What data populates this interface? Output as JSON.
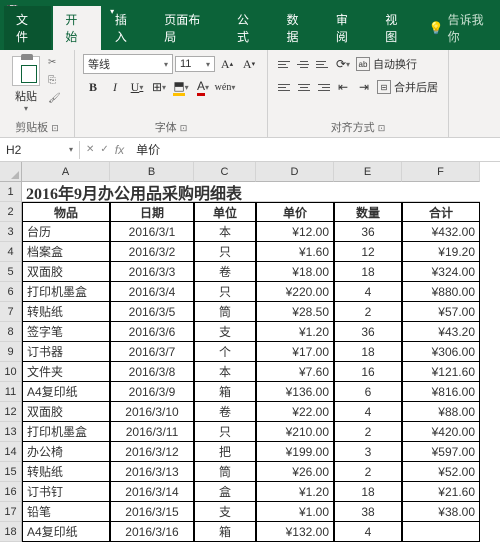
{
  "qat": {
    "save": "💾",
    "undo": "↶",
    "redo": "↷"
  },
  "tabs": {
    "file": "文件",
    "home": "开始",
    "insert": "插入",
    "layout": "页面布局",
    "formulas": "公式",
    "data": "数据",
    "review": "审阅",
    "view": "视图",
    "tell": "告诉我你"
  },
  "ribbon": {
    "paste": "粘贴",
    "clipboard": "剪贴板",
    "font_name": "等线",
    "font_size": "11",
    "font_group": "字体",
    "wrap": "自动换行",
    "merge": "合并后居",
    "align_group": "对齐方式"
  },
  "namebox": "H2",
  "formula": "单价",
  "columns": [
    "A",
    "B",
    "C",
    "D",
    "E",
    "F"
  ],
  "title": "2016年9月办公用品采购明细表",
  "headers": [
    "物品",
    "日期",
    "单位",
    "单价",
    "数量",
    "合计"
  ],
  "chart_data": {
    "type": "table",
    "title": "2016年9月办公用品采购明细表",
    "columns": [
      "物品",
      "日期",
      "单位",
      "单价",
      "数量",
      "合计"
    ],
    "rows": [
      [
        "台历",
        "2016/3/1",
        "本",
        "¥12.00",
        "36",
        "¥432.00"
      ],
      [
        "档案盒",
        "2016/3/2",
        "只",
        "¥1.60",
        "12",
        "¥19.20"
      ],
      [
        "双面胶",
        "2016/3/3",
        "卷",
        "¥18.00",
        "18",
        "¥324.00"
      ],
      [
        "打印机墨盒",
        "2016/3/4",
        "只",
        "¥220.00",
        "4",
        "¥880.00"
      ],
      [
        "转贴纸",
        "2016/3/5",
        "筒",
        "¥28.50",
        "2",
        "¥57.00"
      ],
      [
        "签字笔",
        "2016/3/6",
        "支",
        "¥1.20",
        "36",
        "¥43.20"
      ],
      [
        "订书器",
        "2016/3/7",
        "个",
        "¥17.00",
        "18",
        "¥306.00"
      ],
      [
        "文件夹",
        "2016/3/8",
        "本",
        "¥7.60",
        "16",
        "¥121.60"
      ],
      [
        "A4复印纸",
        "2016/3/9",
        "箱",
        "¥136.00",
        "6",
        "¥816.00"
      ],
      [
        "双面胶",
        "2016/3/10",
        "卷",
        "¥22.00",
        "4",
        "¥88.00"
      ],
      [
        "打印机墨盒",
        "2016/3/11",
        "只",
        "¥210.00",
        "2",
        "¥420.00"
      ],
      [
        "办公椅",
        "2016/3/12",
        "把",
        "¥199.00",
        "3",
        "¥597.00"
      ],
      [
        "转贴纸",
        "2016/3/13",
        "筒",
        "¥26.00",
        "2",
        "¥52.00"
      ],
      [
        "订书钉",
        "2016/3/14",
        "盒",
        "¥1.20",
        "18",
        "¥21.60"
      ],
      [
        "铅笔",
        "2016/3/15",
        "支",
        "¥1.00",
        "38",
        "¥38.00"
      ],
      [
        "A4复印纸",
        "2016/3/16",
        "箱",
        "¥132.00",
        "4",
        ""
      ]
    ]
  }
}
